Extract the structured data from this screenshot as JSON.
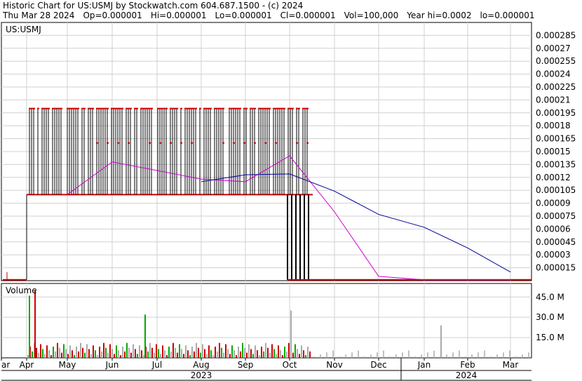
{
  "header": {
    "title": "Historic Chart for US:USMJ by Stockwatch.com 604.687.1500 - (c) 2024",
    "date": "Thu Mar 28 2024",
    "open": "Op=0.000001",
    "high": "Hi=0.000001",
    "low": "Lo=0.000001",
    "close": "Cl=0.000001",
    "volume": "Vol=100,000",
    "year_high": "Year hi=0.0002",
    "year_low": "lo=0.000001"
  },
  "colors": {
    "price_down": "#cc0000",
    "price_up": "#000000",
    "ma_short": "#cc00cc",
    "ma_long": "#000099",
    "vol_up": "#00aa00",
    "vol_down": "#cc0000",
    "vol_neutral": "#aaaaaa"
  },
  "chart_data": [
    {
      "type": "bar",
      "title": "US:USMJ",
      "ylim": [
        0,
        0.0003
      ],
      "y_ticks": [
        "0.000015",
        "0.00003",
        "0.000045",
        "0.00006",
        "0.000075",
        "0.00009",
        "0.000105",
        "0.00012",
        "0.000135",
        "0.00015",
        "0.000165",
        "0.00018",
        "0.000195",
        "0.00021",
        "0.000225",
        "0.00024",
        "0.000255",
        "0.00027",
        "0.000285"
      ],
      "x_tick_labels": [
        "ar",
        "Apr",
        "May",
        "Jun",
        "Jul",
        "Aug",
        "Sep",
        "Oct",
        "Nov",
        "Dec",
        "Jan",
        "Feb",
        "Mar"
      ],
      "year_labels": [
        "2023",
        "2024"
      ],
      "price_segments": [
        {
          "from": "Mar 2023",
          "to": "early Apr 2023",
          "low": 1e-06,
          "high": 1e-05
        },
        {
          "from": "Apr 2023",
          "to": "mid Oct 2023",
          "low": 0.0001,
          "high": 0.0002
        },
        {
          "from": "mid Oct 2023",
          "to": "late Oct 2023",
          "low": 1e-06,
          "high": 0.0002
        },
        {
          "from": "Nov 2023",
          "to": "Mar 2024",
          "low": 1e-06,
          "high": 1e-06
        }
      ],
      "series": [
        {
          "color": "#cc00cc",
          "x": [
            "May",
            "Jun",
            "Jul",
            "Aug",
            "Sep",
            "Oct",
            "Nov",
            "Dec",
            "Jan",
            "Feb",
            "Mar"
          ],
          "values": [
            0.0001,
            0.000138,
            0.000128,
            0.000118,
            0.000115,
            0.000145,
            8e-05,
            5e-06,
            1e-06,
            1e-06,
            1e-06
          ]
        },
        {
          "color": "#000099",
          "x": [
            "Aug",
            "Sep",
            "Oct",
            "Nov",
            "Dec",
            "Jan",
            "Feb",
            "Mar"
          ],
          "values": [
            0.000115,
            0.000123,
            0.000124,
            0.000104,
            7.7e-05,
            6.2e-05,
            3.8e-05,
            1e-05
          ]
        }
      ]
    },
    {
      "type": "bar",
      "title": "Volume",
      "ylim": [
        0,
        55
      ],
      "y_ticks": [
        "15.0 M",
        "30.0 M",
        "45.0 M"
      ],
      "peaks": [
        {
          "x": "Apr",
          "value": 50,
          "color": "#cc0000"
        },
        {
          "x": "Apr",
          "value": 46,
          "color": "#00aa00"
        },
        {
          "x": "Jul",
          "value": 32,
          "color": "#00aa00"
        },
        {
          "x": "Oct",
          "value": 35,
          "color": "#aaaaaa"
        },
        {
          "x": "Jan",
          "value": 24,
          "color": "#aaaaaa"
        }
      ]
    }
  ]
}
